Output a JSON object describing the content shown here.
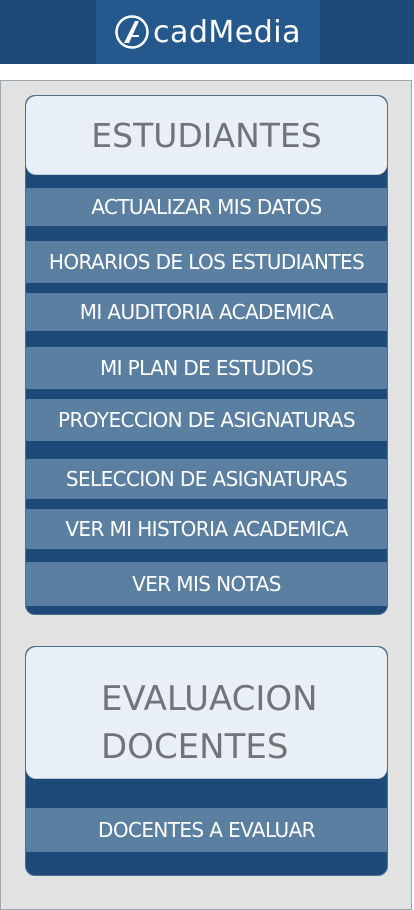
{
  "header": {
    "logo_text": "cadMedia"
  },
  "panels": [
    {
      "title": "ESTUDIANTES",
      "items": [
        "ACTUALIZAR MIS DATOS",
        "HORARIOS DE LOS ESTUDIANTES",
        "MI AUDITORIA ACADEMICA",
        "MI PLAN DE ESTUDIOS",
        "PROYECCION DE ASIGNATURAS",
        "SELECCION DE ASIGNATURAS",
        "VER MI HISTORIA ACADEMICA",
        "VER MIS NOTAS"
      ]
    },
    {
      "title_line1": "EVALUACION",
      "title_line2": "DOCENTES",
      "items": [
        "DOCENTES A EVALUAR"
      ]
    }
  ],
  "colors": {
    "header_bg": "#1d4a78",
    "logo_bg": "#25588c",
    "panel_bg": "#1d4a78",
    "item_bg": "#5a7fa0",
    "panel_header_bg": "#e9eff6",
    "frame_bg": "#e2e2e2"
  }
}
